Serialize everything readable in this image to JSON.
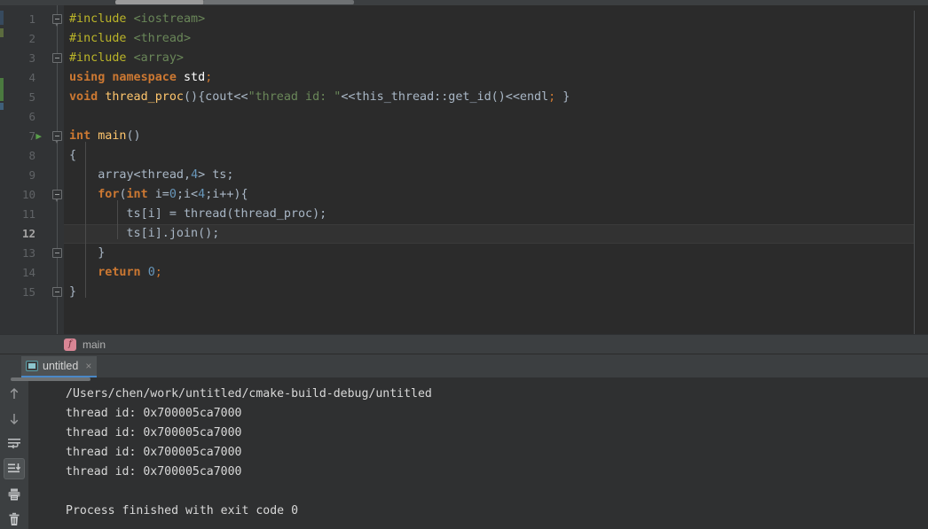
{
  "app": {
    "theme_bg": "#2b2b2b",
    "gutter_bg": "#313335",
    "panel_bg": "#3c3f41",
    "console_bg": "#2f3031",
    "accent": "#4a88c7"
  },
  "editor": {
    "language": "cpp",
    "current_line": 12,
    "run_marker_line": 7,
    "line_numbers": [
      "1",
      "2",
      "3",
      "4",
      "5",
      "6",
      "7",
      "8",
      "9",
      "10",
      "11",
      "12",
      "13",
      "14",
      "15"
    ],
    "lines": [
      {
        "n": 1,
        "tokens": [
          {
            "t": "#include ",
            "c": "tok-pre"
          },
          {
            "t": "<iostream>",
            "c": "tok-hdr"
          }
        ]
      },
      {
        "n": 2,
        "tokens": [
          {
            "t": "#include ",
            "c": "tok-pre"
          },
          {
            "t": "<thread>",
            "c": "tok-hdr"
          }
        ]
      },
      {
        "n": 3,
        "tokens": [
          {
            "t": "#include ",
            "c": "tok-pre"
          },
          {
            "t": "<array>",
            "c": "tok-hdr"
          }
        ]
      },
      {
        "n": 4,
        "tokens": [
          {
            "t": "using namespace ",
            "c": "tok-kw"
          },
          {
            "t": "std",
            "c": "tok-std"
          },
          {
            "t": ";",
            "c": "tok-semi"
          }
        ]
      },
      {
        "n": 5,
        "tokens": [
          {
            "t": "void ",
            "c": "tok-kw"
          },
          {
            "t": "thread_proc",
            "c": "tok-fn"
          },
          {
            "t": "(){cout<<",
            "c": "tok-op"
          },
          {
            "t": "\"thread id: \"",
            "c": "tok-str"
          },
          {
            "t": "<<this_thread::get_id()<<endl",
            "c": "tok-op"
          },
          {
            "t": ";",
            "c": "tok-semi"
          },
          {
            "t": " }",
            "c": "tok-op"
          }
        ]
      },
      {
        "n": 6,
        "tokens": []
      },
      {
        "n": 7,
        "tokens": [
          {
            "t": "int ",
            "c": "tok-kw"
          },
          {
            "t": "main",
            "c": "tok-fn"
          },
          {
            "t": "()",
            "c": "tok-op"
          }
        ]
      },
      {
        "n": 8,
        "tokens": [
          {
            "t": "{",
            "c": "tok-op"
          }
        ]
      },
      {
        "n": 9,
        "tokens": [
          {
            "t": "    array<thread,",
            "c": "tok-id"
          },
          {
            "t": "4",
            "c": "tok-num"
          },
          {
            "t": "> ts;",
            "c": "tok-id"
          }
        ]
      },
      {
        "n": 10,
        "tokens": [
          {
            "t": "    ",
            "c": "tok-id"
          },
          {
            "t": "for",
            "c": "tok-kw"
          },
          {
            "t": "(",
            "c": "tok-op"
          },
          {
            "t": "int",
            "c": "tok-kw"
          },
          {
            "t": " i=",
            "c": "tok-id"
          },
          {
            "t": "0",
            "c": "tok-num"
          },
          {
            "t": ";i<",
            "c": "tok-id"
          },
          {
            "t": "4",
            "c": "tok-num"
          },
          {
            "t": ";i++){",
            "c": "tok-id"
          }
        ]
      },
      {
        "n": 11,
        "tokens": [
          {
            "t": "        ts[i] = thread(thread_proc);",
            "c": "tok-id"
          }
        ]
      },
      {
        "n": 12,
        "tokens": [
          {
            "t": "        ts[i].join();",
            "c": "tok-id"
          }
        ]
      },
      {
        "n": 13,
        "tokens": [
          {
            "t": "    }",
            "c": "tok-op"
          }
        ]
      },
      {
        "n": 14,
        "tokens": [
          {
            "t": "    ",
            "c": "tok-id"
          },
          {
            "t": "return ",
            "c": "tok-kw"
          },
          {
            "t": "0",
            "c": "tok-num"
          },
          {
            "t": ";",
            "c": "tok-semi"
          }
        ]
      },
      {
        "n": 15,
        "tokens": [
          {
            "t": "}",
            "c": "tok-op"
          }
        ]
      }
    ]
  },
  "breadcrumb": {
    "icon": "function-icon",
    "icon_letter": "f",
    "label": "main"
  },
  "console_tabs": {
    "tool_window_label": ":",
    "tabs": [
      {
        "label": "untitled",
        "icon": "console-icon",
        "close": "×",
        "active": true
      }
    ]
  },
  "console_toolbar": {
    "buttons": [
      {
        "name": "scroll-up-icon",
        "title": "Up the Stack Trace"
      },
      {
        "name": "scroll-down-icon",
        "title": "Down the Stack Trace"
      },
      {
        "name": "soft-wrap-icon",
        "title": "Soft-Wrap"
      },
      {
        "name": "scroll-to-end-icon",
        "title": "Scroll to the end",
        "active": true
      },
      {
        "name": "print-icon",
        "title": "Print"
      },
      {
        "name": "trash-icon",
        "title": "Clear All"
      }
    ]
  },
  "console_output": {
    "lines": [
      "/Users/chen/work/untitled/cmake-build-debug/untitled",
      "thread id: 0x700005ca7000",
      "thread id: 0x700005ca7000",
      "thread id: 0x700005ca7000",
      "thread id: 0x700005ca7000",
      "",
      "Process finished with exit code 0"
    ]
  }
}
